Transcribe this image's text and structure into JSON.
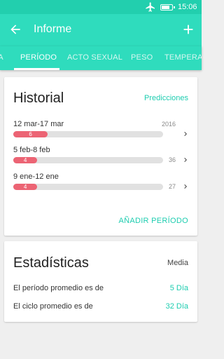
{
  "status_bar": {
    "time": "15:06",
    "icons": [
      "airplane-icon",
      "battery-icon"
    ]
  },
  "app_bar": {
    "title": "Informe",
    "color": "#2fdcbd"
  },
  "tabs": [
    {
      "label": "ÍA"
    },
    {
      "label": "PERÍODO",
      "active": true
    },
    {
      "label": "ACTO SEXUAL"
    },
    {
      "label": "PESO"
    },
    {
      "label": "TEMPERATURA"
    }
  ],
  "history": {
    "title": "Historial",
    "action": "Predicciones",
    "periods": [
      {
        "range": "12 mar-17 mar",
        "days": "6",
        "cycle": "",
        "year": "2016",
        "fill_fraction": 0.23
      },
      {
        "range": "5 feb-8 feb",
        "days": "4",
        "cycle": "36",
        "year": "",
        "fill_fraction": 0.16
      },
      {
        "range": "9 ene-12 ene",
        "days": "4",
        "cycle": "27",
        "year": "",
        "fill_fraction": 0.16
      }
    ],
    "add_label": "AÑADIR PERÍODO"
  },
  "stats": {
    "title": "Estadísticas",
    "mode": "Media",
    "rows": [
      {
        "label": "El período promedio es de",
        "value": "5 Día"
      },
      {
        "label": "El ciclo promedio es de",
        "value": "32 Día"
      }
    ]
  },
  "colors": {
    "accent": "#1ecdb0",
    "period_bar": "#ec6474"
  }
}
